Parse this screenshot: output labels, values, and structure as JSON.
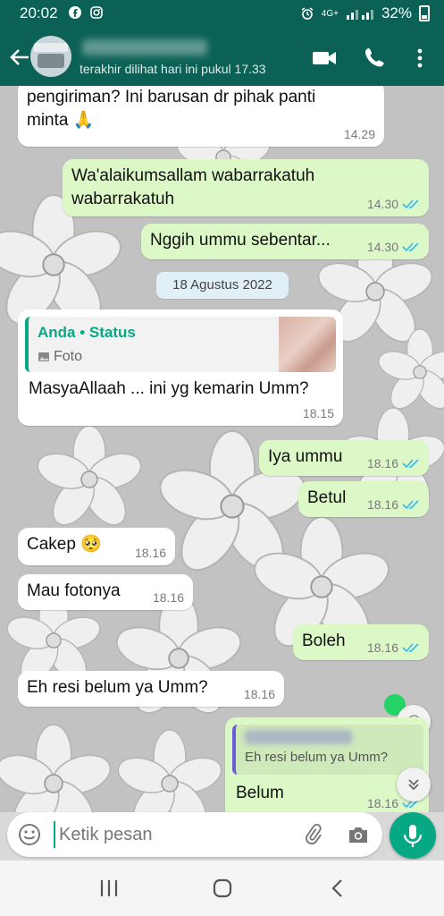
{
  "status_bar": {
    "time": "20:02",
    "battery": "32%",
    "network": "4G+",
    "left_icons": [
      "facebook-icon",
      "instagram-icon"
    ]
  },
  "header": {
    "last_seen": "terakhir dilihat hari ini pukul 17.33"
  },
  "messages": [
    {
      "dir": "in",
      "text": "pengiriman? Ini barusan dr pihak panti\nminta 🙏",
      "time": "14.29"
    },
    {
      "dir": "out",
      "text": "Wa'alaikumsallam wabarrakatuh\nwabarrakatuh",
      "time": "14.30"
    },
    {
      "dir": "out",
      "text": "Nggih ummu sebentar...",
      "time": "14.30"
    },
    {
      "dir": "in",
      "quote_author": "Anda • Status",
      "quote_type": "Foto",
      "text": "MasyaAllaah ... ini yg kemarin Umm?",
      "time": "18.15"
    },
    {
      "dir": "out",
      "text": "Iya ummu",
      "time": "18.16"
    },
    {
      "dir": "out",
      "text": "Betul",
      "time": "18.16"
    },
    {
      "dir": "in",
      "text": "Cakep 🥺",
      "time": "18.16"
    },
    {
      "dir": "in",
      "text": "Mau fotonya",
      "time": "18.16"
    },
    {
      "dir": "out",
      "text": "Boleh",
      "time": "18.16"
    },
    {
      "dir": "in",
      "text": "Eh resi belum ya Umm?",
      "time": "18.16"
    },
    {
      "dir": "out",
      "reply_text": "Eh resi belum ya Umm?",
      "text": "Belum",
      "time": "18.16"
    }
  ],
  "date_separator": "18 Agustus 2022",
  "input": {
    "placeholder": "Ketik pesan"
  },
  "colors": {
    "header": "#0b6156",
    "outgoing": "#dcf8c6",
    "incoming": "#ffffff",
    "accent": "#07a884",
    "read_tick": "#34b7f1"
  },
  "mention_badge": "@",
  "scroll_icon": "double-chevron-down-icon"
}
